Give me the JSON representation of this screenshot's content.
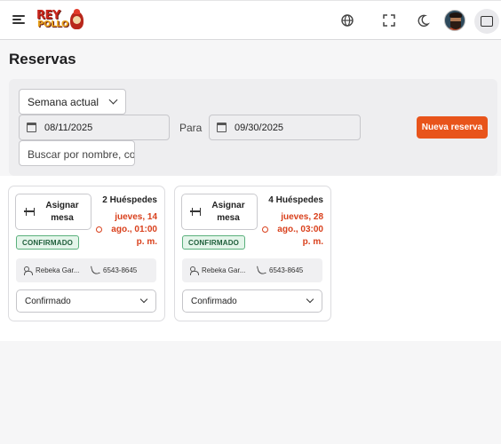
{
  "header": {
    "logo_line1": "REY",
    "logo_line2": "POLLO",
    "icons": [
      "menu-icon",
      "globe-icon",
      "fullscreen-icon",
      "moon-icon",
      "avatar",
      "tablet-icon"
    ]
  },
  "page": {
    "title": "Reservas"
  },
  "filters": {
    "period_select": "Semana actual",
    "date_from": "08/11/2025",
    "between_label": "Para",
    "date_to": "09/30/2025",
    "new_button": "Nueva reserva",
    "search_placeholder": "Buscar por nombre, correo"
  },
  "colors": {
    "accent": "#e8541b",
    "date_text": "#d9401c",
    "badge_bg": "#e4f5ea",
    "badge_border": "#5ab07c"
  },
  "reservations": [
    {
      "assign_label": "Asignar mesa",
      "guests": "2 Huéspedes",
      "datetime": "jueves, 14 ago., 01:00 p. m.",
      "status_badge": "CONFIRMADO",
      "name": "Rebeka Gar...",
      "phone": "6543-8645",
      "status_select": "Confirmado"
    },
    {
      "assign_label": "Asignar mesa",
      "guests": "4 Huéspedes",
      "datetime": "jueves, 28 ago., 03:00 p. m.",
      "status_badge": "CONFIRMADO",
      "name": "Rebeka Gar...",
      "phone": "6543-8645",
      "status_select": "Confirmado"
    }
  ]
}
